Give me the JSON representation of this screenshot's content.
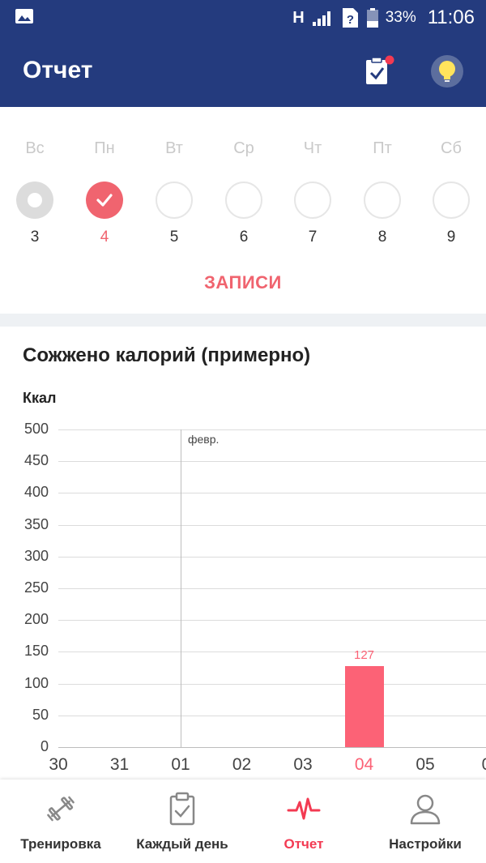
{
  "status_bar": {
    "network": "H",
    "battery": "33%",
    "time": "11:06"
  },
  "app_bar": {
    "title": "Отчет",
    "tasks_icon": "clipboard-check-icon",
    "tip_icon": "lightbulb-icon"
  },
  "week": {
    "days": [
      {
        "name": "Вс",
        "num": "3",
        "state": "past"
      },
      {
        "name": "Пн",
        "num": "4",
        "state": "done"
      },
      {
        "name": "Вт",
        "num": "5",
        "state": "future"
      },
      {
        "name": "Ср",
        "num": "6",
        "state": "future"
      },
      {
        "name": "Чт",
        "num": "7",
        "state": "future"
      },
      {
        "name": "Пт",
        "num": "8",
        "state": "future"
      },
      {
        "name": "Сб",
        "num": "9",
        "state": "future"
      }
    ],
    "records_label": "ЗАПИСИ"
  },
  "colors": {
    "primary": "#243b7e",
    "accent": "#fc6276",
    "inactive_text": "#c9c9c9"
  },
  "chart": {
    "title": "Сожжено калорий (примерно)",
    "unit": "Ккал",
    "month_label": "февр."
  },
  "chart_data": {
    "type": "bar",
    "title": "Сожжено калорий (примерно)",
    "ylabel": "Ккал",
    "ylim": [
      0,
      500
    ],
    "yticks": [
      0,
      50,
      100,
      150,
      200,
      250,
      300,
      350,
      400,
      450,
      500
    ],
    "categories": [
      "30",
      "31",
      "01",
      "02",
      "03",
      "04",
      "05",
      "0"
    ],
    "values": [
      0,
      0,
      0,
      0,
      0,
      127,
      0,
      0
    ],
    "data_labels": [
      "",
      "",
      "",
      "",
      "",
      "127",
      "",
      ""
    ],
    "highlighted_category": "04",
    "grid": true
  },
  "bottom_nav": {
    "items": [
      {
        "label": "Тренировка",
        "icon": "dumbbell-icon",
        "active": false
      },
      {
        "label": "Каждый день",
        "icon": "clipboard-check-icon",
        "active": false
      },
      {
        "label": "Отчет",
        "icon": "heartbeat-icon",
        "active": true
      },
      {
        "label": "Настройки",
        "icon": "person-icon",
        "active": false
      }
    ]
  }
}
